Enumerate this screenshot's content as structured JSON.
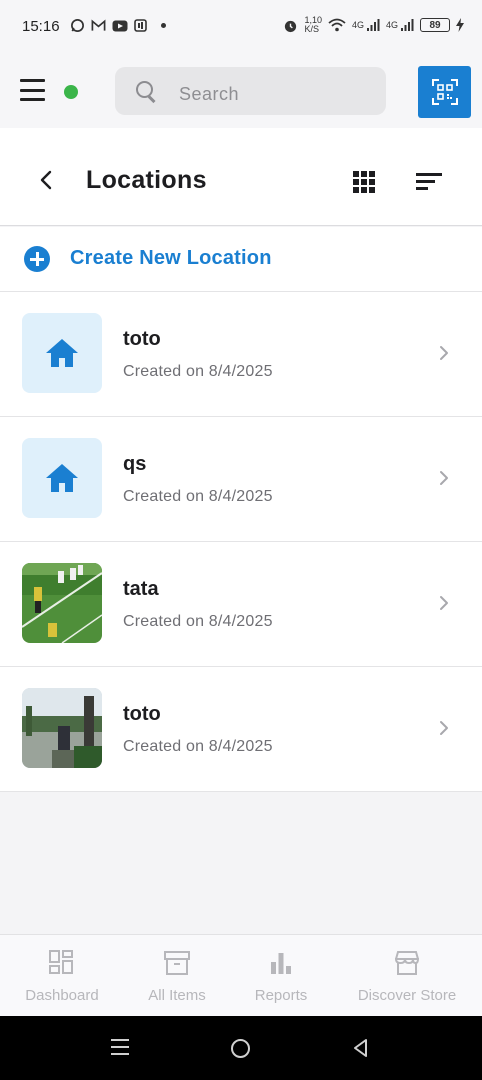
{
  "status_bar": {
    "time": "15:16",
    "net_speed": "1,10\nK/S",
    "net_speed_top": "1,10",
    "net_speed_bottom": "K/S",
    "sim1": "4G",
    "sim2": "4G",
    "battery": "89"
  },
  "header": {
    "search_placeholder": "Search",
    "online_color": "#3bb54a",
    "accent": "#1a7fd1"
  },
  "page": {
    "title": "Locations",
    "create_label": "Create New Location"
  },
  "locations": [
    {
      "name": "toto",
      "date": "Created on 8/4/2025",
      "thumb": "home-icon"
    },
    {
      "name": "qs",
      "date": "Created on 8/4/2025",
      "thumb": "home-icon"
    },
    {
      "name": "tata",
      "date": "Created on 8/4/2025",
      "thumb": "soccer-photo"
    },
    {
      "name": "toto",
      "date": "Created on 8/4/2025",
      "thumb": "lake-photo"
    }
  ],
  "bottom_nav": [
    {
      "label": "Dashboard",
      "icon": "dashboard-icon"
    },
    {
      "label": "All Items",
      "icon": "archive-box-icon"
    },
    {
      "label": "Reports",
      "icon": "bar-chart-icon"
    },
    {
      "label": "Discover Store",
      "icon": "store-icon"
    }
  ]
}
